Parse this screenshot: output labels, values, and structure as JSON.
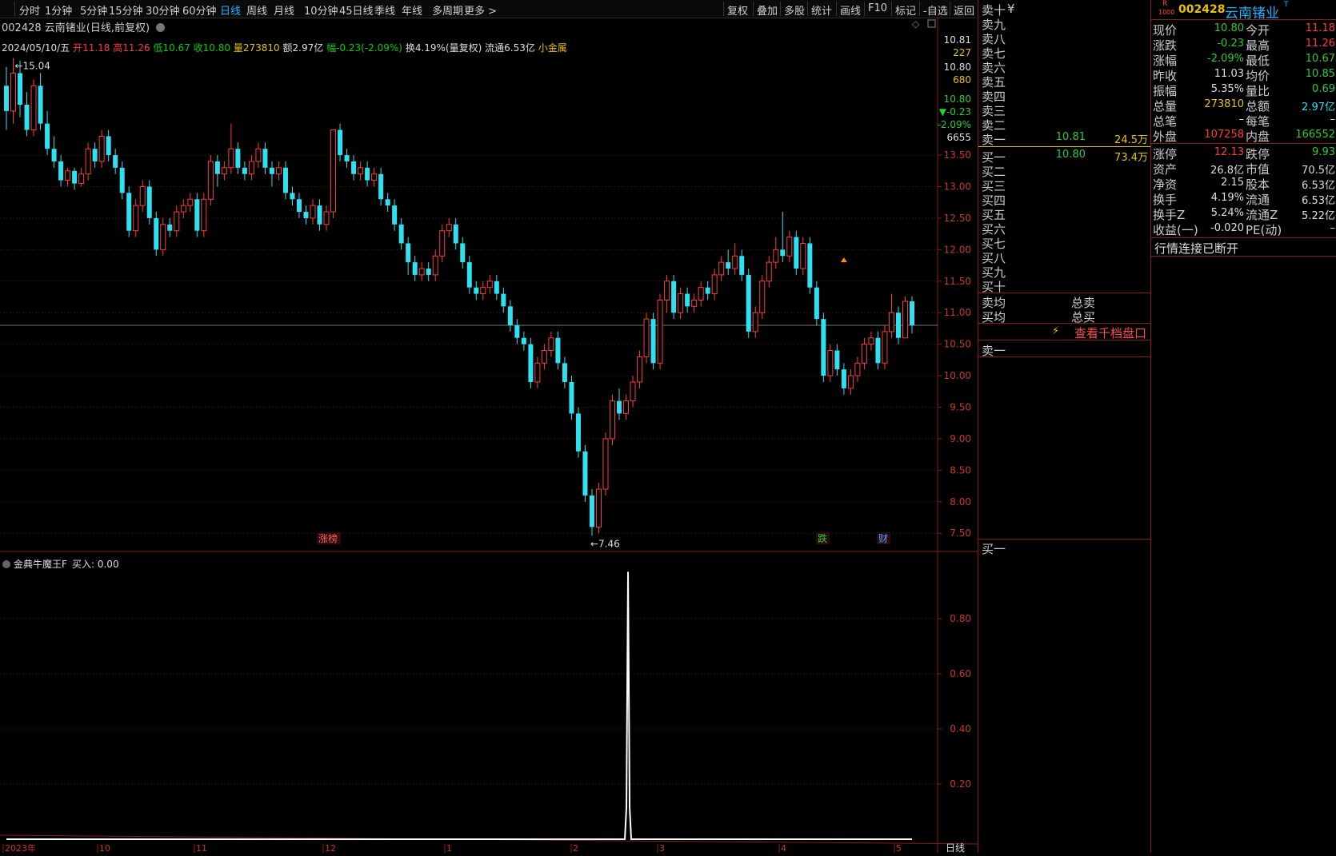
{
  "toolbar": {
    "periods": [
      "分时",
      "1分钟",
      "5分钟",
      "15分钟",
      "30分钟",
      "60分钟",
      "日线",
      "周线",
      "月线",
      "10分钟",
      "45日线",
      "季线",
      "年线",
      "多周期",
      "更多 >"
    ],
    "active_period": "日线",
    "tools": [
      "复权",
      "叠加",
      "多股",
      "统计",
      "画线",
      "F10",
      "标记",
      "-自选",
      "返回"
    ]
  },
  "header": {
    "title": "002428 云南锗业(日线,前复权)",
    "date": "2024/05/10/五",
    "open_lbl": "开",
    "open": "11.18",
    "high_lbl": "高",
    "high": "11.26",
    "low_lbl": "低",
    "low": "10.67",
    "close_lbl": "收",
    "close": "10.80",
    "vol_lbl": "量",
    "vol": "273810",
    "amt_lbl": "额",
    "amt": "2.97亿",
    "chg_lbl": "幅",
    "chg": "-0.23(-2.09%)",
    "turn": "换4.19%(量复权)",
    "float": "流通6.53亿",
    "sector": "小金属"
  },
  "price_axis": {
    "ticks": [
      "13.50",
      "13.00",
      "12.50",
      "12.00",
      "11.50",
      "11.00",
      "10.50",
      "10.00",
      "9.50",
      "9.00",
      "8.50",
      "8.00",
      "7.50"
    ],
    "side_info": [
      "10.81",
      "227",
      "10.80",
      "680",
      "10.80",
      "▼-0.23",
      "-2.09%",
      "6655"
    ]
  },
  "annotations": {
    "high_mark": "15.04",
    "low_mark": "7.46",
    "tag1": "涨榜",
    "tag2": "跌",
    "tag3": "财"
  },
  "indicator": {
    "title": "金典牛魔王F",
    "value_label": "买入: 0.00",
    "ticks": [
      "0.80",
      "0.60",
      "0.40",
      "0.20"
    ]
  },
  "date_axis": {
    "labels": [
      "2023年",
      "10",
      "11",
      "12",
      "1",
      "2",
      "3",
      "4",
      "5"
    ],
    "period": "日线"
  },
  "chart_data": {
    "type": "candlestick",
    "ylim": [
      7.3,
      15.2
    ],
    "candles": [
      [
        14.6,
        14.2,
        14.9,
        13.9
      ],
      [
        14.2,
        14.8,
        15.04,
        14.0
      ],
      [
        14.8,
        14.3,
        15.0,
        14.1
      ],
      [
        14.3,
        13.9,
        14.5,
        13.8
      ],
      [
        13.9,
        14.6,
        14.7,
        13.8
      ],
      [
        14.6,
        14.0,
        14.8,
        13.9
      ],
      [
        14.0,
        13.6,
        14.2,
        13.5
      ],
      [
        13.6,
        13.4,
        13.8,
        13.3
      ],
      [
        13.4,
        13.1,
        13.5,
        13.0
      ],
      [
        13.1,
        13.25,
        13.3,
        13.0
      ],
      [
        13.25,
        13.05,
        13.3,
        12.95
      ],
      [
        13.05,
        13.2,
        13.3,
        13.0
      ],
      [
        13.2,
        13.6,
        13.7,
        13.1
      ],
      [
        13.6,
        13.4,
        13.7,
        13.3
      ],
      [
        13.4,
        13.8,
        13.9,
        13.3
      ],
      [
        13.8,
        13.5,
        13.9,
        13.4
      ],
      [
        13.5,
        13.3,
        13.6,
        13.2
      ],
      [
        13.3,
        12.9,
        13.4,
        12.8
      ],
      [
        12.9,
        12.3,
        13.0,
        12.2
      ],
      [
        12.3,
        12.7,
        12.8,
        12.2
      ],
      [
        12.7,
        13.0,
        13.1,
        12.6
      ],
      [
        13.0,
        12.5,
        13.1,
        12.4
      ],
      [
        12.5,
        12.0,
        12.6,
        11.9
      ],
      [
        12.0,
        12.4,
        12.5,
        11.9
      ],
      [
        12.4,
        12.3,
        12.5,
        12.2
      ],
      [
        12.3,
        12.6,
        12.7,
        12.2
      ],
      [
        12.6,
        12.7,
        12.8,
        12.5
      ],
      [
        12.7,
        12.8,
        12.9,
        12.6
      ],
      [
        12.8,
        12.3,
        12.9,
        12.2
      ],
      [
        12.3,
        12.8,
        12.9,
        12.2
      ],
      [
        12.8,
        13.4,
        13.5,
        12.7
      ],
      [
        13.4,
        13.2,
        13.5,
        13.0
      ],
      [
        13.2,
        13.3,
        13.4,
        13.1
      ],
      [
        13.3,
        13.6,
        14.0,
        13.2
      ],
      [
        13.6,
        13.3,
        13.7,
        13.2
      ],
      [
        13.3,
        13.2,
        13.4,
        13.1
      ],
      [
        13.2,
        13.4,
        13.5,
        13.1
      ],
      [
        13.4,
        13.6,
        13.7,
        13.3
      ],
      [
        13.6,
        13.3,
        13.7,
        13.2
      ],
      [
        13.3,
        13.2,
        13.4,
        13.0
      ],
      [
        13.2,
        13.3,
        13.4,
        13.1
      ],
      [
        13.3,
        12.9,
        13.4,
        12.8
      ],
      [
        12.9,
        12.8,
        13.0,
        12.7
      ],
      [
        12.8,
        12.6,
        12.9,
        12.5
      ],
      [
        12.6,
        12.5,
        12.7,
        12.4
      ],
      [
        12.5,
        12.7,
        12.8,
        12.4
      ],
      [
        12.7,
        12.4,
        12.8,
        12.3
      ],
      [
        12.4,
        12.6,
        12.7,
        12.3
      ],
      [
        12.6,
        13.9,
        13.9,
        12.5
      ],
      [
        13.9,
        13.5,
        14.0,
        13.4
      ],
      [
        13.5,
        13.4,
        13.6,
        13.3
      ],
      [
        13.4,
        13.2,
        13.5,
        13.1
      ],
      [
        13.2,
        13.3,
        13.4,
        13.1
      ],
      [
        13.3,
        13.1,
        13.4,
        13.0
      ],
      [
        13.1,
        13.2,
        13.3,
        13.0
      ],
      [
        13.2,
        12.8,
        13.3,
        12.7
      ],
      [
        12.8,
        12.7,
        12.9,
        12.6
      ],
      [
        12.7,
        12.4,
        12.8,
        12.3
      ],
      [
        12.4,
        12.1,
        12.5,
        12.0
      ],
      [
        12.1,
        11.8,
        12.2,
        11.6
      ],
      [
        11.8,
        11.6,
        11.9,
        11.5
      ],
      [
        11.6,
        11.7,
        11.8,
        11.5
      ],
      [
        11.7,
        11.6,
        11.8,
        11.5
      ],
      [
        11.6,
        11.9,
        12.0,
        11.5
      ],
      [
        11.9,
        12.3,
        12.4,
        11.8
      ],
      [
        12.3,
        12.4,
        12.5,
        12.2
      ],
      [
        12.4,
        12.1,
        12.5,
        12.0
      ],
      [
        12.1,
        11.8,
        12.2,
        11.7
      ],
      [
        11.8,
        11.4,
        11.9,
        11.3
      ],
      [
        11.4,
        11.3,
        11.5,
        11.2
      ],
      [
        11.3,
        11.4,
        11.5,
        11.2
      ],
      [
        11.4,
        11.5,
        11.6,
        11.3
      ],
      [
        11.5,
        11.3,
        11.6,
        11.2
      ],
      [
        11.3,
        11.1,
        11.4,
        11.0
      ],
      [
        11.1,
        10.8,
        11.2,
        10.7
      ],
      [
        10.8,
        10.6,
        10.9,
        10.5
      ],
      [
        10.6,
        10.5,
        10.7,
        10.4
      ],
      [
        10.5,
        9.9,
        10.6,
        9.8
      ],
      [
        9.9,
        10.2,
        10.3,
        9.8
      ],
      [
        10.2,
        10.4,
        10.5,
        10.1
      ],
      [
        10.4,
        10.6,
        10.7,
        10.3
      ],
      [
        10.6,
        10.2,
        10.7,
        10.1
      ],
      [
        10.2,
        9.9,
        10.3,
        9.8
      ],
      [
        9.9,
        9.4,
        10.0,
        9.3
      ],
      [
        9.4,
        8.8,
        9.5,
        8.7
      ],
      [
        8.8,
        8.1,
        8.9,
        8.0
      ],
      [
        8.1,
        7.6,
        8.2,
        7.46
      ],
      [
        7.6,
        8.2,
        8.3,
        7.5
      ],
      [
        8.2,
        9.0,
        9.1,
        8.1
      ],
      [
        9.0,
        9.6,
        9.7,
        8.9
      ],
      [
        9.6,
        9.4,
        9.8,
        9.3
      ],
      [
        9.4,
        9.6,
        9.7,
        9.3
      ],
      [
        9.6,
        9.9,
        10.0,
        9.5
      ],
      [
        9.9,
        10.3,
        10.4,
        9.8
      ],
      [
        10.3,
        10.9,
        11.0,
        10.2
      ],
      [
        10.9,
        10.2,
        11.0,
        10.1
      ],
      [
        10.2,
        11.2,
        11.3,
        10.1
      ],
      [
        11.2,
        11.5,
        11.6,
        11.0
      ],
      [
        11.5,
        11.0,
        11.6,
        10.9
      ],
      [
        11.0,
        11.3,
        11.4,
        10.9
      ],
      [
        11.3,
        11.1,
        11.4,
        11.0
      ],
      [
        11.1,
        11.2,
        11.3,
        11.0
      ],
      [
        11.2,
        11.4,
        11.5,
        11.1
      ],
      [
        11.4,
        11.3,
        11.5,
        11.2
      ],
      [
        11.3,
        11.6,
        11.7,
        11.2
      ],
      [
        11.6,
        11.8,
        11.9,
        11.5
      ],
      [
        11.8,
        11.7,
        12.0,
        11.6
      ],
      [
        11.7,
        11.9,
        12.1,
        11.6
      ],
      [
        11.9,
        11.6,
        12.0,
        11.5
      ],
      [
        11.6,
        10.7,
        11.7,
        10.6
      ],
      [
        10.7,
        11.0,
        11.1,
        10.6
      ],
      [
        11.0,
        11.5,
        11.6,
        10.9
      ],
      [
        11.5,
        11.8,
        11.9,
        11.4
      ],
      [
        11.8,
        12.0,
        12.2,
        11.7
      ],
      [
        12.0,
        11.9,
        12.6,
        11.8
      ],
      [
        11.9,
        12.2,
        12.3,
        11.8
      ],
      [
        12.2,
        11.7,
        12.3,
        11.6
      ],
      [
        11.7,
        12.1,
        12.2,
        11.6
      ],
      [
        12.1,
        11.4,
        12.2,
        11.3
      ],
      [
        11.4,
        10.9,
        11.5,
        10.8
      ],
      [
        10.9,
        10.0,
        11.0,
        9.9
      ],
      [
        10.0,
        10.4,
        10.5,
        9.9
      ],
      [
        10.4,
        10.1,
        10.5,
        10.0
      ],
      [
        10.1,
        9.8,
        10.2,
        9.7
      ],
      [
        9.8,
        10.0,
        10.1,
        9.7
      ],
      [
        10.0,
        10.2,
        10.3,
        9.9
      ],
      [
        10.2,
        10.5,
        10.6,
        10.1
      ],
      [
        10.5,
        10.6,
        10.7,
        10.4
      ],
      [
        10.6,
        10.2,
        10.7,
        10.1
      ],
      [
        10.2,
        10.7,
        10.8,
        10.1
      ],
      [
        10.7,
        11.0,
        11.3,
        10.6
      ],
      [
        11.0,
        10.6,
        11.1,
        10.5
      ],
      [
        10.6,
        11.18,
        11.26,
        10.6
      ],
      [
        11.18,
        10.8,
        11.26,
        10.67
      ]
    ],
    "signal": {
      "index": 92,
      "value": 0.97
    }
  },
  "orderbook": {
    "sell_labels": [
      "卖十",
      "卖九",
      "卖八",
      "卖七",
      "卖六",
      "卖五",
      "卖四",
      "卖三",
      "卖二",
      "卖一"
    ],
    "sell1_price": "10.81",
    "sell1_vol": "24.5万",
    "buy_labels": [
      "买一",
      "买二",
      "买三",
      "买四",
      "买五",
      "买六",
      "买七",
      "买八",
      "买九",
      "买十"
    ],
    "buy1_price": "10.80",
    "buy1_vol": "73.4万",
    "yen": "¥",
    "avg_sell": "卖均",
    "avg_buy": "买均",
    "total_sell": "总卖",
    "total_buy": "总买",
    "deep_link": "查看千档盘口",
    "queue_sell": "卖一",
    "queue_buy": "买一"
  },
  "quote": {
    "badge": "R",
    "badge_sub": "1000",
    "code": "002428",
    "name": "云南锗业",
    "name_sup": "T",
    "rows": [
      {
        "l1": "现价",
        "v1": "10.80",
        "c1": "grn",
        "l2": "今开",
        "v2": "11.18",
        "c2": "red"
      },
      {
        "l1": "涨跌",
        "v1": "-0.23",
        "c1": "grn",
        "l2": "最高",
        "v2": "11.26",
        "c2": "red"
      },
      {
        "l1": "涨幅",
        "v1": "-2.09%",
        "c1": "grn",
        "l2": "最低",
        "v2": "10.67",
        "c2": "grn"
      },
      {
        "l1": "昨收",
        "v1": "11.03",
        "c1": "wht",
        "l2": "均价",
        "v2": "10.85",
        "c2": "grn"
      },
      {
        "l1": "振幅",
        "v1": "5.35%",
        "c1": "wht",
        "l2": "量比",
        "v2": "0.69",
        "c2": "grn"
      },
      {
        "l1": "总量",
        "v1": "273810",
        "c1": "yel",
        "l2": "总额",
        "v2": "2.97亿",
        "c2": "cyn"
      },
      {
        "l1": "总笔",
        "v1": "–",
        "c1": "wht",
        "l2": "每笔",
        "v2": "–",
        "c2": "wht"
      },
      {
        "l1": "外盘",
        "v1": "107258",
        "c1": "red",
        "l2": "内盘",
        "v2": "166552",
        "c2": "grn"
      },
      {
        "l1": "涨停",
        "v1": "12.13",
        "c1": "red",
        "l2": "跌停",
        "v2": "9.93",
        "c2": "grn"
      },
      {
        "l1": "资产",
        "v1": "26.8亿",
        "c1": "wht",
        "l2": "市值",
        "v2": "70.5亿",
        "c2": "wht"
      },
      {
        "l1": "净资",
        "v1": "2.15",
        "c1": "wht",
        "l2": "股本",
        "v2": "6.53亿",
        "c2": "wht"
      },
      {
        "l1": "换手",
        "v1": "4.19%",
        "c1": "wht",
        "l2": "流通",
        "v2": "6.53亿",
        "c2": "wht"
      },
      {
        "l1": "换手Z",
        "v1": "5.24%",
        "c1": "wht",
        "l2": "流通Z",
        "v2": "5.22亿",
        "c2": "wht"
      },
      {
        "l1": "收益(一)",
        "v1": "-0.020",
        "c1": "wht",
        "l2": "PE(动)",
        "v2": "–",
        "c2": "wht"
      }
    ],
    "status": "行情连接已断开"
  },
  "colors": {
    "up": "#ff3b3b",
    "down": "#2fe0f0",
    "accent": "#8b1a1a",
    "signal": "#ffffff"
  }
}
